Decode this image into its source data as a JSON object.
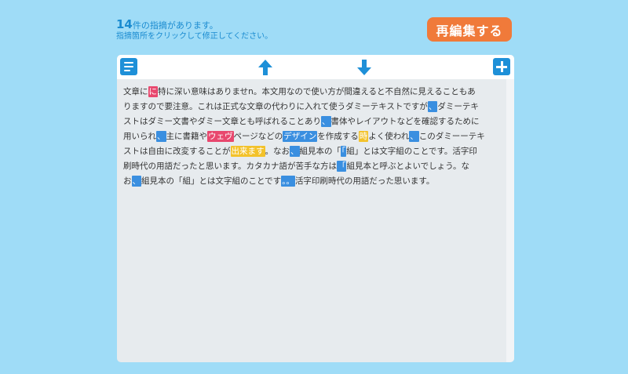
{
  "header": {
    "count": "14",
    "count_suffix": "件の指摘があります。",
    "instruction": "指摘箇所をクリックして修正してください。",
    "reedit_label": "再編集する"
  },
  "toolbar": {
    "icons": [
      "document-icon",
      "arrow-up-icon",
      "arrow-down-icon",
      "plus-icon"
    ]
  },
  "colors": {
    "background": "#9fdcf7",
    "accent_blue": "#1e90d8",
    "button_orange": "#f07a3a",
    "mark_red": "#e8486e",
    "mark_blue": "#3a8fe0",
    "mark_yellow": "#f3c22a"
  },
  "document": {
    "lines": [
      [
        {
          "t": "文章に"
        },
        {
          "t": "に",
          "m": "red"
        },
        {
          "t": "特に深い意味はありませn。本文用なので使い方が間違えると不自然に見えることもあ"
        }
      ],
      [
        {
          "t": "りますので要注意。これは正式な文章の代わりに入れて使うダミーテキストですが"
        },
        {
          "t": "、",
          "m": "blue"
        },
        {
          "t": "ダミーテキ"
        }
      ],
      [
        {
          "t": "ストはダミー文書やダミー文章とも呼ばれることあり"
        },
        {
          "t": "、",
          "m": "blue"
        },
        {
          "t": "書体やレイアウトなどを確認するために"
        }
      ],
      [
        {
          "t": "用いられ"
        },
        {
          "t": "、",
          "m": "blue"
        },
        {
          "t": "主に書籍や"
        },
        {
          "t": "ウェヴ",
          "m": "red"
        },
        {
          "t": "ページなどの"
        },
        {
          "t": "デザイン",
          "m": "blue"
        },
        {
          "t": "を作成する"
        },
        {
          "t": "時",
          "m": "yellow"
        },
        {
          "t": "よく使われ"
        },
        {
          "t": "、",
          "m": "blue"
        },
        {
          "t": "このダミーーテキ"
        }
      ],
      [
        {
          "t": "ストは自由に改変することが"
        },
        {
          "t": "出来ます",
          "m": "yellow"
        },
        {
          "t": "。なお"
        },
        {
          "t": "、",
          "m": "blue"
        },
        {
          "t": "組見本の「"
        },
        {
          "t": "「",
          "m": "blue"
        },
        {
          "t": "組」とは文字組のことです。活字印"
        }
      ],
      [
        {
          "t": "刷時代の用語だったと思います。カタカナ語が苦手な方は"
        },
        {
          "t": "「",
          "m": "blue"
        },
        {
          "t": "組見本と呼ぶとよいでしょう。な"
        }
      ],
      [
        {
          "t": "お"
        },
        {
          "t": "、",
          "m": "blue"
        },
        {
          "t": "組見本の「組」とは文字組のことです"
        },
        {
          "t": "。。",
          "m": "blue"
        },
        {
          "t": "活字印刷時代の用語だった思います。"
        }
      ]
    ]
  }
}
